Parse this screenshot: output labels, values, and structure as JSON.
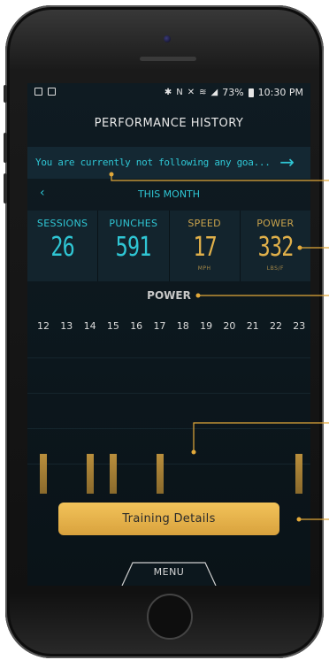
{
  "status_bar": {
    "battery": "73%",
    "time": "10:30 PM",
    "icons": [
      "image-notification-icon",
      "doc-notification-icon",
      "bluetooth-icon",
      "nfc-icon",
      "mute-icon",
      "wifi-icon",
      "signal-icon",
      "battery-icon"
    ]
  },
  "header": {
    "title": "PERFORMANCE HISTORY"
  },
  "goal": {
    "text": "You are currently not following any goa...",
    "arrow": "→"
  },
  "period": {
    "back": "‹",
    "label": "THIS MONTH"
  },
  "stats": [
    {
      "label": "SESSIONS",
      "value": "26",
      "unit": ""
    },
    {
      "label": "PUNCHES",
      "value": "591",
      "unit": ""
    },
    {
      "label": "SPEED",
      "value": "17",
      "unit": "MPH"
    },
    {
      "label": "POWER",
      "value": "332",
      "unit": "LBS/F"
    }
  ],
  "chart_data": {
    "type": "bar",
    "title": "POWER",
    "categories": [
      "12",
      "13",
      "14",
      "15",
      "16",
      "17",
      "18",
      "19",
      "20",
      "21",
      "22",
      "23"
    ],
    "values": [
      0.26,
      0,
      0.26,
      0.26,
      0,
      0.26,
      0,
      0,
      0,
      0,
      0,
      0.26
    ],
    "ylim": [
      0,
      1
    ],
    "grid": true
  },
  "actions": {
    "training_details": "Training Details",
    "menu": "MENU"
  },
  "colors": {
    "accent_cyan": "#2fc6d4",
    "accent_gold": "#e0b04a",
    "button_gold": "#f2c35a",
    "background": "#0f1b22"
  }
}
